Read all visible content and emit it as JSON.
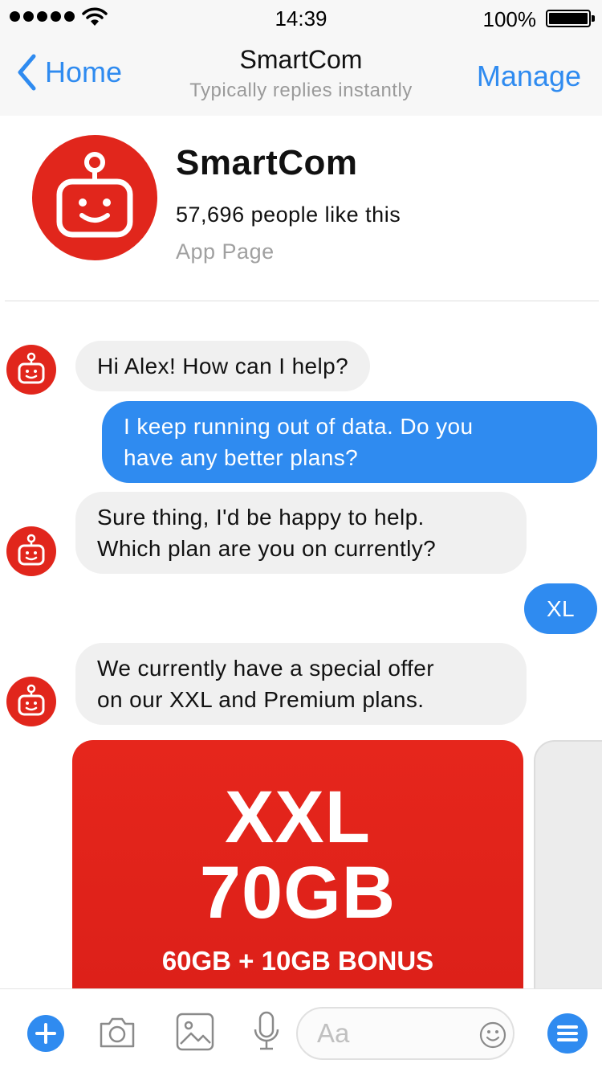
{
  "status_bar": {
    "time": "14:39",
    "battery": "100%"
  },
  "nav": {
    "back_label": "Home",
    "title": "SmartCom",
    "subtitle": "Typically replies instantly",
    "manage_label": "Manage"
  },
  "page": {
    "name": "SmartCom",
    "likes": "57,696 people like this",
    "type": "App Page"
  },
  "messages": [
    {
      "from": "bot",
      "text": "Hi Alex! How can I help?"
    },
    {
      "from": "user",
      "lines": [
        "I keep running out of data. Do you",
        "have any better plans?"
      ]
    },
    {
      "from": "bot",
      "lines": [
        "Sure thing, I'd be happy to help.",
        "Which plan are you on currently?"
      ]
    },
    {
      "from": "user",
      "text": "XL"
    },
    {
      "from": "bot",
      "lines": [
        "We currently have a special offer",
        "on our XXL and Premium plans."
      ]
    }
  ],
  "card": {
    "line1": "XXL",
    "line2": "70GB",
    "line3": "60GB + 10GB BONUS"
  },
  "composer": {
    "placeholder": "Aa"
  },
  "colors": {
    "brand_red": "#e1261c",
    "accent_blue": "#2f8bf0",
    "bot_bubble": "#f0f0f0"
  },
  "icons": [
    "wifi-icon",
    "battery-icon",
    "back-chevron-icon",
    "robot-icon",
    "plus-icon",
    "camera-icon",
    "image-icon",
    "microphone-icon",
    "emoji-icon",
    "menu-icon"
  ]
}
